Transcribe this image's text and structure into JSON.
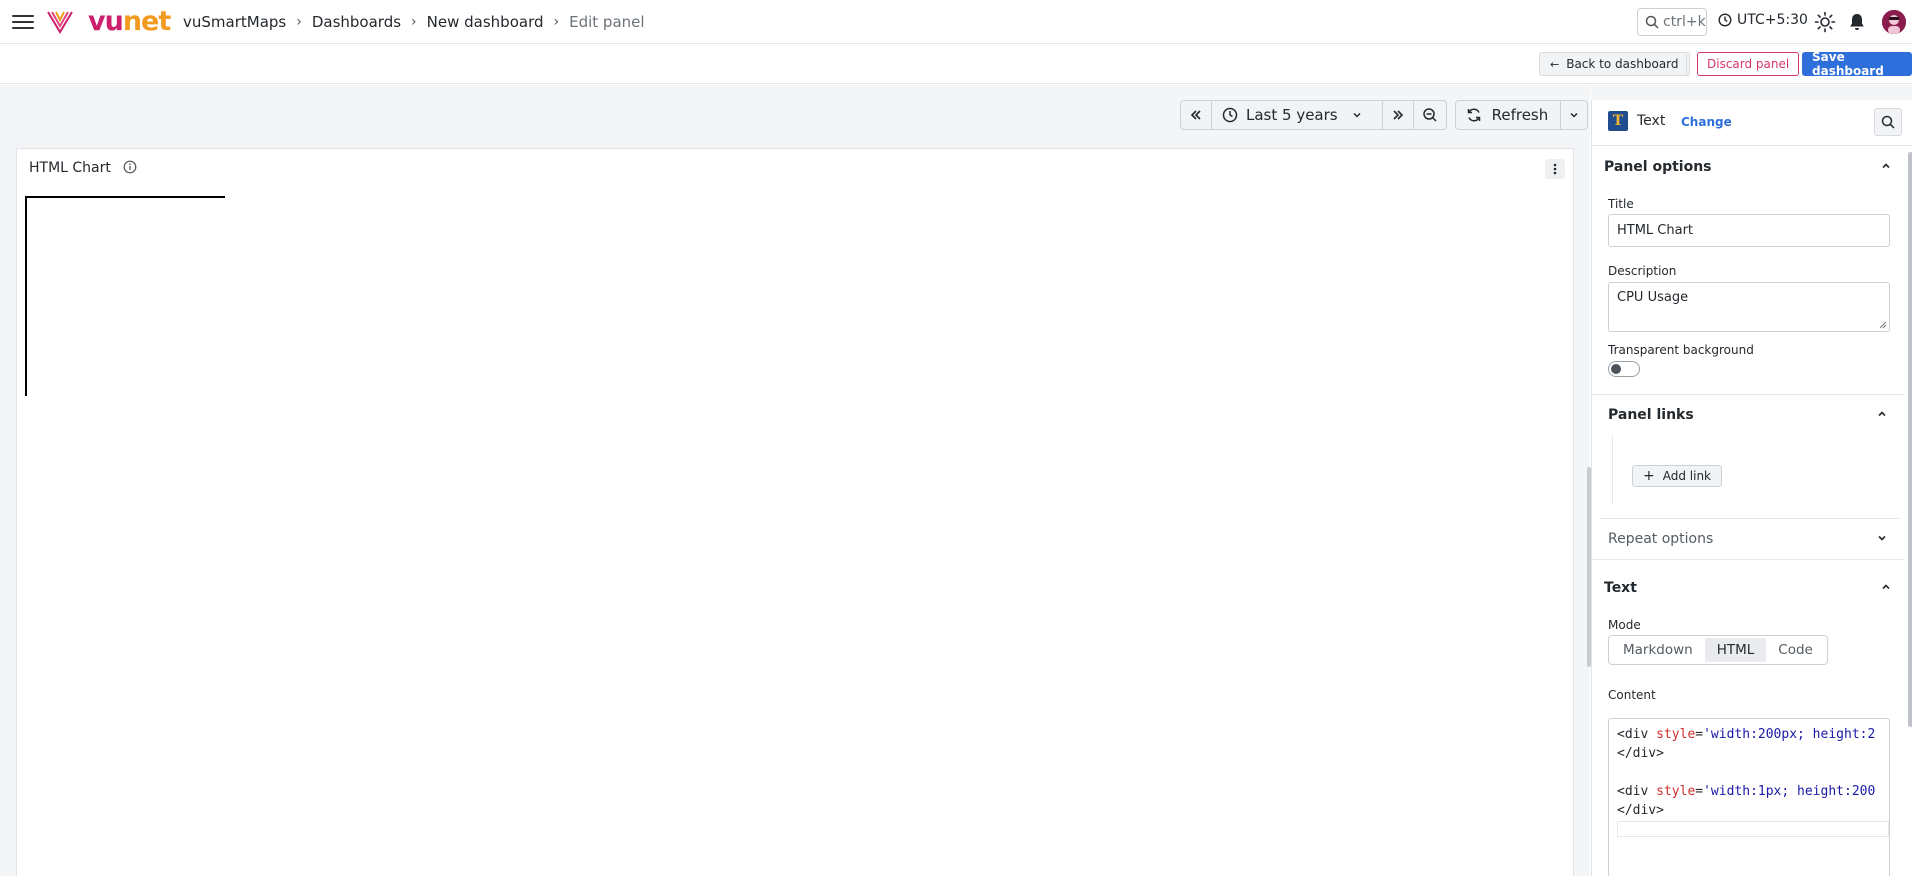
{
  "brand": {
    "part1": "vu",
    "part2": "net"
  },
  "breadcrumb": {
    "items": [
      "vuSmartMaps",
      "Dashboards",
      "New dashboard"
    ],
    "current": "Edit panel"
  },
  "topbar": {
    "search_hint": "ctrl+k",
    "timezone": "UTC+5:30"
  },
  "toolbar": {
    "back_label": "Back to dashboard",
    "discard_label": "Discard panel",
    "save_label": "Save dashboard"
  },
  "time": {
    "range_label": "Last 5 years",
    "refresh_label": "Refresh"
  },
  "panel": {
    "title": "HTML Chart"
  },
  "options": {
    "viz_name": "Text",
    "change_label": "Change",
    "panel_options": {
      "heading": "Panel options",
      "title_label": "Title",
      "title_value": "HTML Chart",
      "description_label": "Description",
      "description_value": "CPU Usage",
      "transparent_label": "Transparent background",
      "transparent_on": false
    },
    "panel_links": {
      "heading": "Panel links",
      "add_label": "Add link"
    },
    "repeat_options": {
      "heading": "Repeat options"
    },
    "text": {
      "heading": "Text",
      "mode_label": "Mode",
      "modes": [
        "Markdown",
        "HTML",
        "Code"
      ],
      "active_mode": "HTML",
      "content_label": "Content",
      "code": {
        "line1_open": "<div",
        "line1_attr": "style",
        "line1_eq": "=",
        "line1_str": "'width:200px; height:2",
        "line2": "</div>",
        "line4_open": "<div",
        "line4_attr": "style",
        "line4_eq": "=",
        "line4_str": "'width:1px; height:200",
        "line5": "</div>"
      }
    }
  },
  "icons": {
    "menu": "hamburger-icon",
    "search": "search-icon",
    "clock": "clock-icon",
    "theme": "sun-icon",
    "notifications": "bell-icon",
    "info": "info-icon",
    "kebab": "kebab-icon"
  },
  "colors": {
    "accent": "#2f6fdb",
    "danger": "#d63864",
    "brand_pink": "#cc1f6e",
    "brand_orange": "#f29b20"
  }
}
